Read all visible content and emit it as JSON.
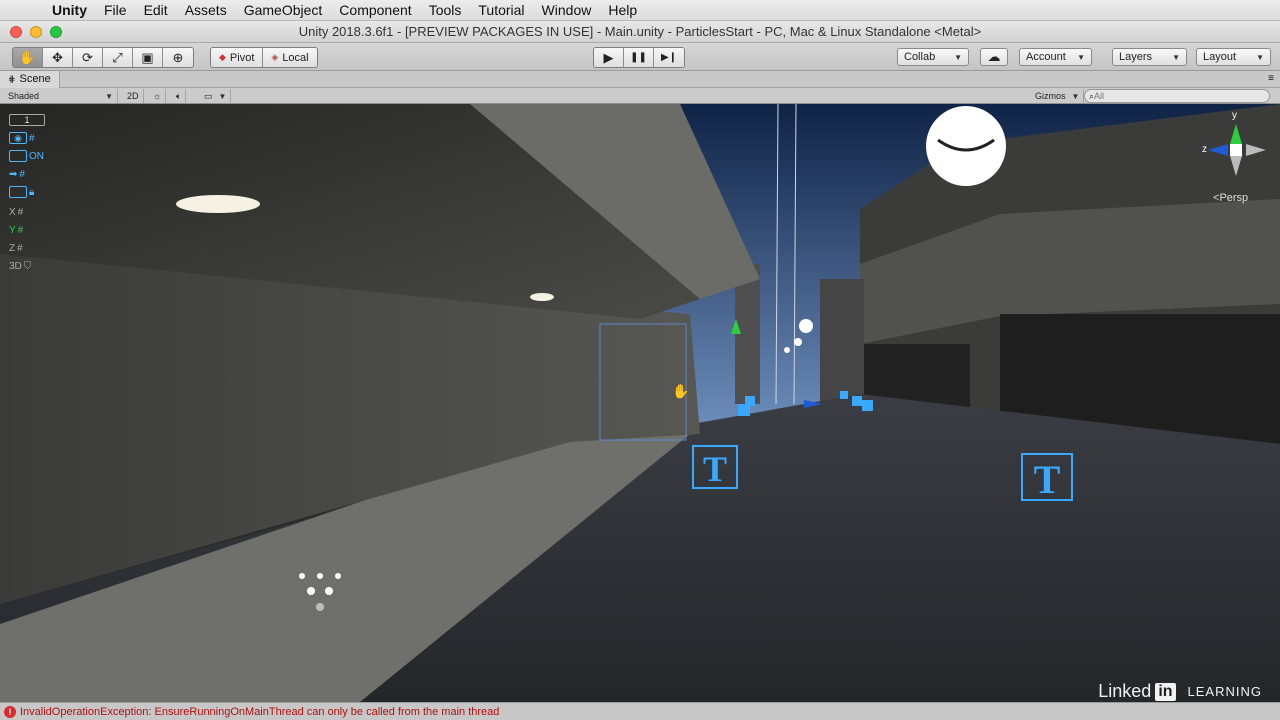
{
  "menubar": {
    "apple_icon": "apple-icon",
    "items": [
      "Unity",
      "File",
      "Edit",
      "Assets",
      "GameObject",
      "Component",
      "Tools",
      "Tutorial",
      "Window",
      "Help"
    ]
  },
  "window": {
    "title": "Unity 2018.3.6f1 - [PREVIEW PACKAGES IN USE] - Main.unity - ParticlesStart - PC, Mac & Linux Standalone <Metal>",
    "traffic_colors": [
      "#ff5f57",
      "#febc2e",
      "#28c840"
    ]
  },
  "toolbar": {
    "transform_tools": [
      "hand-icon",
      "move-icon",
      "rotate-icon",
      "scale-icon",
      "rect-icon",
      "transform-icon"
    ],
    "transform_glyphs": [
      "✋",
      "✥",
      "⟳",
      "⤢",
      "▣",
      "⊕"
    ],
    "pivot_label": "Pivot",
    "local_label": "Local",
    "play_glyph": "▶",
    "pause_glyph": "❚❚",
    "step_glyph": "▶❙",
    "collab_label": "Collab",
    "cloud_glyph": "☁",
    "account_label": "Account",
    "layers_label": "Layers",
    "layout_label": "Layout"
  },
  "scene": {
    "tab_label": "Scene",
    "shading_mode": "Shaded",
    "mode_2d": "2D",
    "gizmos_label": "Gizmos",
    "search_placeholder": "All",
    "persp_label": "Persp"
  },
  "overlay": {
    "count": "1",
    "on_label": "ON",
    "x": "X",
    "y": "Y",
    "z": "Z",
    "three_d": "3D",
    "gizmo_y": "y",
    "gizmo_z": "z"
  },
  "status": {
    "message": "InvalidOperationException: EnsureRunningOnMainThread can only be called from the main thread",
    "error_glyph": "!"
  },
  "watermark": {
    "linked": "Linked",
    "in": "in",
    "learning": "LEARNING"
  },
  "colors": {
    "accent_blue": "#3aa8ff",
    "error_red": "#b01010"
  }
}
